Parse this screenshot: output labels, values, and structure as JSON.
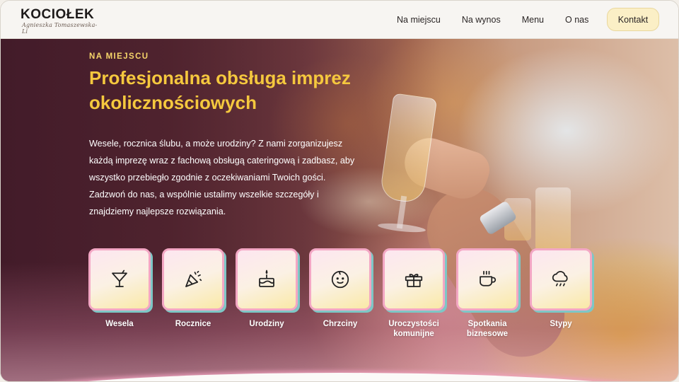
{
  "brand": {
    "name": "KOCIOŁEK",
    "tagline": "Agnieszka Tomaszewska-Li"
  },
  "nav": {
    "items": [
      "Na miejscu",
      "Na wynos",
      "Menu",
      "O nas"
    ],
    "contact": "Kontakt"
  },
  "hero": {
    "eyebrow": "NA MIEJSCU",
    "headline": "Profesjonalna obsługa imprez okolicznościowych",
    "body": "Wesele, rocznica ślubu, a może urodziny? Z nami zorganizujesz każdą imprezę wraz z fachową obsługą cateringową i zadbasz, aby wszystko przebiegło zgodnie z oczekiwaniami Twoich gości. Zadzwoń do nas, a wspólnie ustalimy wszelkie szczegóły i znajdziemy najlepsze rozwiązania."
  },
  "tiles": [
    {
      "label": "Wesela",
      "icon": "cocktail-glass-icon"
    },
    {
      "label": "Rocznice",
      "icon": "party-popper-icon"
    },
    {
      "label": "Urodziny",
      "icon": "birthday-cake-icon"
    },
    {
      "label": "Chrzciny",
      "icon": "baby-face-icon"
    },
    {
      "label": "Uroczystości komunijne",
      "icon": "gift-icon"
    },
    {
      "label": "Spotkania biznesowe",
      "icon": "coffee-cup-icon"
    },
    {
      "label": "Stypy",
      "icon": "rain-cloud-icon"
    }
  ],
  "colors": {
    "accent": "#f5c83e",
    "contact_bg": "#fbefc6",
    "tile_border": "#f3a7c4",
    "tile_shadow": "#7ec7c6"
  }
}
